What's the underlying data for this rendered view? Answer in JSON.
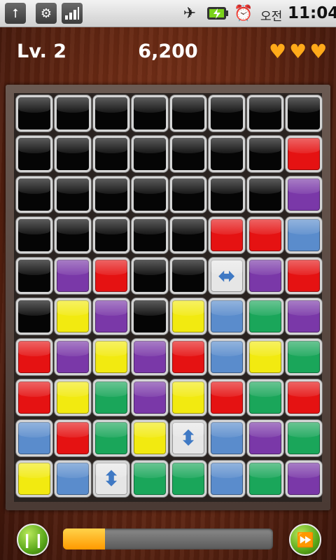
{
  "status_bar": {
    "left_icons": [
      "usb-icon",
      "android-debug-icon",
      "signal-bars-icon"
    ],
    "right_icons": [
      "airplane-mode-icon",
      "battery-charging-icon",
      "alarm-clock-icon"
    ],
    "ampm": "오전",
    "time": "11:04"
  },
  "hud": {
    "level": "Lv. 2",
    "score": "6,200",
    "lives": 3,
    "heart_color": "#ffaa1a"
  },
  "board": {
    "rows": 10,
    "cols": 8,
    "colors": {
      "K": "#050505",
      "R": "#e51212",
      "P": "#7a38a8",
      "B": "#5a8ccc",
      "Y": "#f2ea10",
      "G": "#1aa65a",
      "W": "#e6e6e6"
    },
    "tiles": [
      [
        "K",
        "K",
        "K",
        "K",
        "K",
        "K",
        "K",
        "K"
      ],
      [
        "K",
        "K",
        "K",
        "K",
        "K",
        "K",
        "K",
        "R"
      ],
      [
        "K",
        "K",
        "K",
        "K",
        "K",
        "K",
        "K",
        "P"
      ],
      [
        "K",
        "K",
        "K",
        "K",
        "K",
        "R",
        "R",
        "B"
      ],
      [
        "K",
        "P",
        "R",
        "K",
        "K",
        "H",
        "P",
        "R"
      ],
      [
        "K",
        "Y",
        "P",
        "K",
        "Y",
        "B",
        "G",
        "P"
      ],
      [
        "R",
        "P",
        "Y",
        "P",
        "R",
        "B",
        "Y",
        "G"
      ],
      [
        "R",
        "Y",
        "G",
        "P",
        "Y",
        "R",
        "G",
        "R"
      ],
      [
        "B",
        "R",
        "G",
        "Y",
        "V",
        "B",
        "P",
        "G"
      ],
      [
        "Y",
        "B",
        "V",
        "G",
        "G",
        "B",
        "G",
        "P"
      ]
    ],
    "special": {
      "H": "horizontal-swap-tile",
      "V": "vertical-swap-tile"
    }
  },
  "controls": {
    "pause_icon": "pause-icon",
    "fast_forward_icon": "fast-forward-icon",
    "progress": 0.2,
    "accent": "#ff9a00"
  }
}
